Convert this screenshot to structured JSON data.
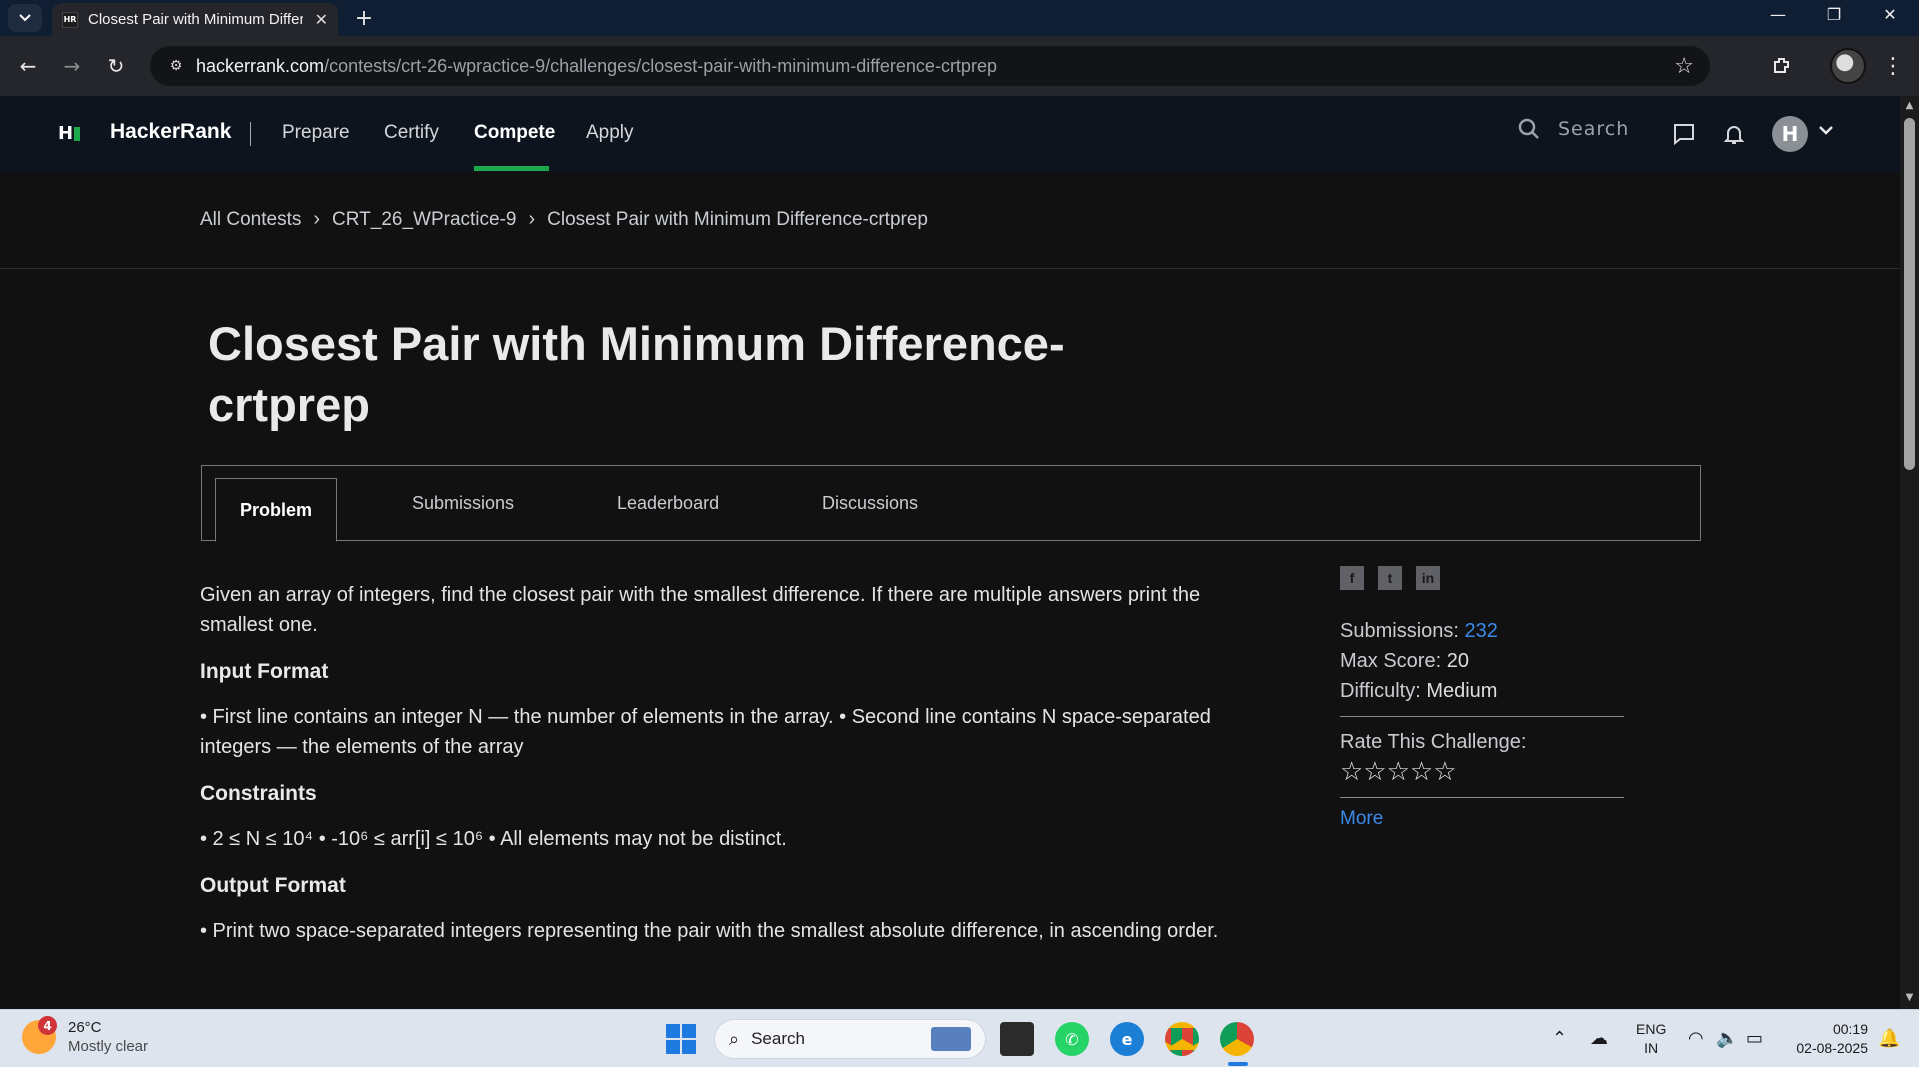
{
  "browser": {
    "tab_title": "Closest Pair with Minimum Difference-crtprep",
    "tab_favicon": "HR",
    "url_host": "hackerrank.com",
    "url_path": "/contests/crt-26-wpractice-9/challenges/closest-pair-with-minimum-difference-crtprep"
  },
  "hr_nav": {
    "logo_letter": "H",
    "brand": "HackerRank",
    "links": [
      "Prepare",
      "Certify",
      "Compete",
      "Apply"
    ],
    "active_link": "Compete",
    "search_placeholder": "Search",
    "avatar_letter": "H",
    "accent_color": "#1ba94c"
  },
  "breadcrumb": [
    "All Contests",
    "CRT_26_WPractice-9",
    "Closest Pair with Minimum Difference-crtprep"
  ],
  "challenge": {
    "title_line1": "Closest Pair with Minimum Difference-",
    "title_line2": "crtprep",
    "tabs": [
      "Problem",
      "Submissions",
      "Leaderboard",
      "Discussions"
    ],
    "active_tab": "Problem",
    "intro": "Given an array of integers, find the closest pair with the smallest difference. If there are multiple answers print the smallest one.",
    "input_heading": "Input Format",
    "input_text": "• First line contains an integer N — the number of elements in the array. • Second line contains N space-separated integers — the elements of the array",
    "constraints_heading": "Constraints",
    "constraints_text": "• 2 ≤ N ≤ 10⁴ • -10⁶ ≤ arr[i] ≤ 10⁶ • All elements may not be distinct.",
    "output_heading": "Output Format",
    "output_text": "• Print two space-separated integers representing the pair with the smallest absolute difference, in ascending order."
  },
  "sidebar": {
    "share_icons": [
      "facebook-icon",
      "twitter-icon",
      "linkedin-icon"
    ],
    "submissions_label": "Submissions:",
    "submissions_value": "232",
    "max_score_label": "Max Score:",
    "max_score_value": "20",
    "difficulty_label": "Difficulty:",
    "difficulty_value": "Medium",
    "rate_label": "Rate This Challenge:",
    "stars": "☆☆☆☆☆",
    "more_link": "More"
  },
  "taskbar": {
    "weather_badge": "4",
    "temperature": "26°C",
    "weather_desc": "Mostly clear",
    "search_placeholder": "Search",
    "lang_line1": "ENG",
    "lang_line2": "IN",
    "time": "00:19",
    "date": "02-08-2025"
  }
}
